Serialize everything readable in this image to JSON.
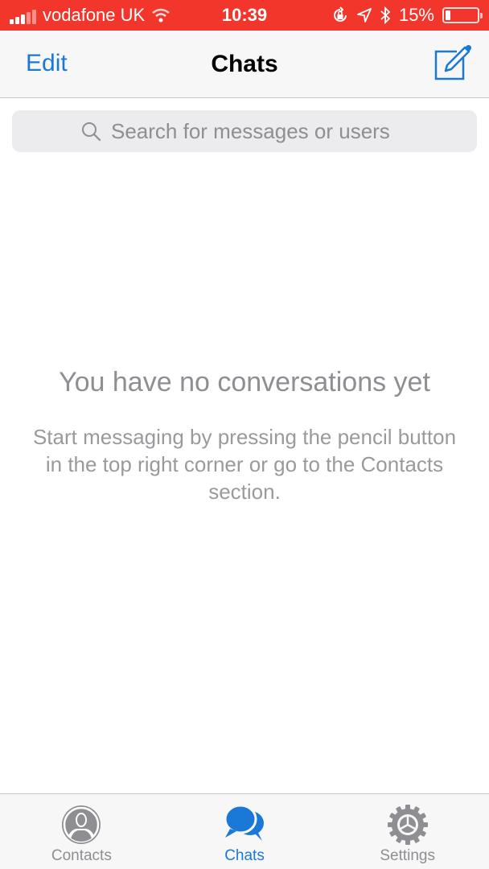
{
  "status_bar": {
    "carrier": "vodafone UK",
    "time": "10:39",
    "battery_percent": "15%",
    "battery_level": 0.15,
    "icons": [
      "signal-icon",
      "wifi-icon",
      "rotation-lock-icon",
      "location-icon",
      "bluetooth-icon",
      "battery-icon"
    ]
  },
  "nav": {
    "edit_label": "Edit",
    "title": "Chats",
    "compose_icon": "compose-pencil-icon"
  },
  "search": {
    "placeholder": "Search for messages or users",
    "value": ""
  },
  "empty_state": {
    "title": "You have no conversations yet",
    "text": "Start messaging by pressing the pencil button in the top right corner or go to the Contacts section."
  },
  "tab_bar": {
    "tabs": [
      {
        "label": "Contacts",
        "icon": "person-icon",
        "active": false
      },
      {
        "label": "Chats",
        "icon": "chat-bubbles-icon",
        "active": true
      },
      {
        "label": "Settings",
        "icon": "gear-icon",
        "active": false
      }
    ]
  },
  "colors": {
    "accent": "#1a78d6",
    "status_bar": "#f2362b",
    "inactive": "#8e8e93"
  }
}
